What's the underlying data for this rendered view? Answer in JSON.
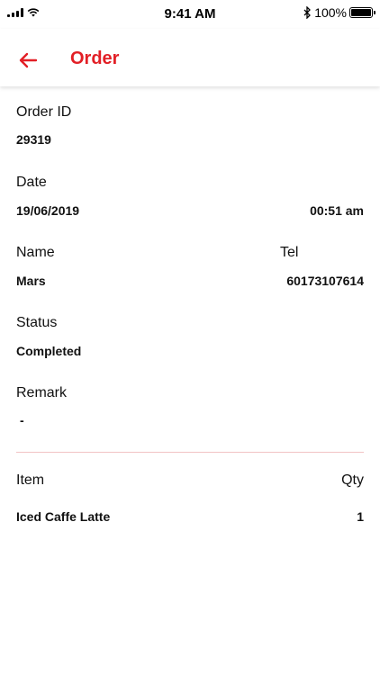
{
  "status_bar": {
    "time": "9:41 AM",
    "battery_text": "100%",
    "bluetooth_glyph": "✱"
  },
  "nav": {
    "title": "Order",
    "back_icon": "arrow-left-icon",
    "accent_color": "#e21f26"
  },
  "order": {
    "id_label": "Order ID",
    "id_value": "29319",
    "date_label": "Date",
    "date_value": "19/06/2019",
    "time_value": "00:51 am",
    "name_label": "Name",
    "name_value": "Mars",
    "tel_label": "Tel",
    "tel_value": "60173107614",
    "status_label": "Status",
    "status_value": "Completed",
    "remark_label": "Remark",
    "remark_value": "-"
  },
  "items": {
    "item_header": "Item",
    "qty_header": "Qty",
    "rows": [
      {
        "name": "Iced Caffe Latte",
        "qty": "1"
      }
    ]
  }
}
